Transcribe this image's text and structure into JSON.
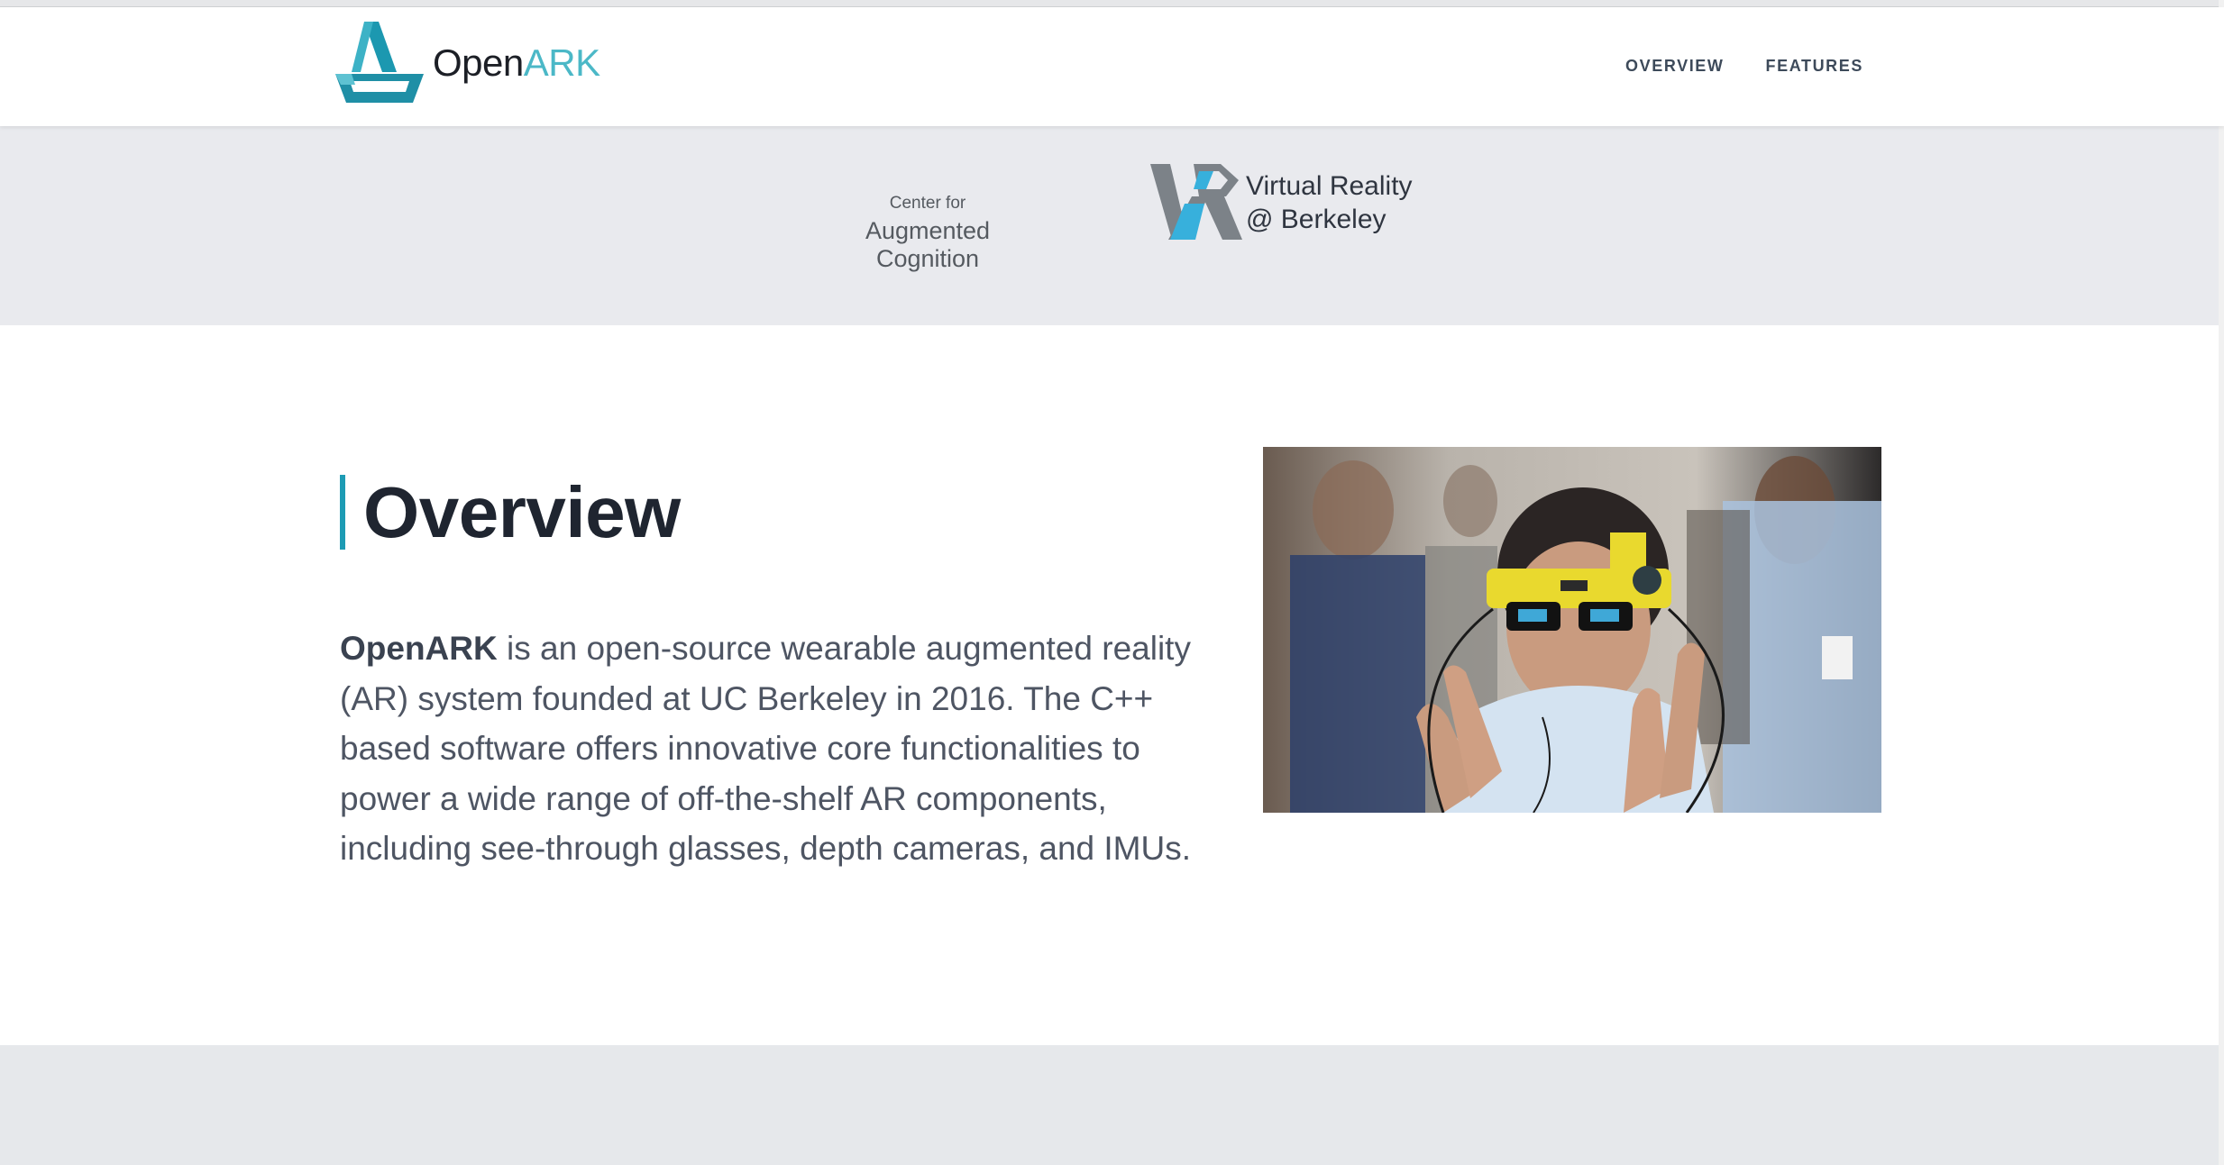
{
  "header": {
    "brand": {
      "open": "Open",
      "ark": "ARK"
    },
    "nav": [
      {
        "label": "OVERVIEW"
      },
      {
        "label": "FEATURES"
      }
    ]
  },
  "partners": {
    "cac": {
      "line1": "Center for",
      "line2": "Augmented Cognition"
    },
    "vr": {
      "line1": "Virtual Reality",
      "line2": "@ Berkeley"
    }
  },
  "overview": {
    "title": "Overview",
    "lead": "OpenARK",
    "body": " is an open-source wearable augmented reality (AR) system founded at UC Berkeley in 2016. The C++ based software offers innovative core functionalities to power a wide range of off-the-shelf AR components, including see-through glasses, depth cameras, and IMUs."
  },
  "colors": {
    "accent": "#1d9bb4",
    "brand_light": "#4bb8c7",
    "partners_bg": "#e9eaee",
    "footer_bg": "#e6e8eb"
  }
}
